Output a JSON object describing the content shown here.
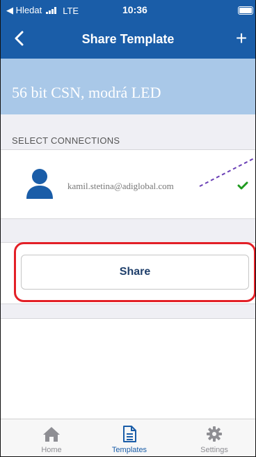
{
  "status_bar": {
    "carrier": "◀ Hledat",
    "network": "LTE",
    "time": "10:36"
  },
  "nav": {
    "title": "Share Template",
    "back_icon": "chevron-left-icon",
    "add_icon": "plus-icon",
    "add_label": "+"
  },
  "template": {
    "name": "56 bit CSN, modrá LED"
  },
  "connections": {
    "section_label": "SELECT CONNECTIONS",
    "items": [
      {
        "email": "kamil.stetina@adiglobal.com",
        "selected": true
      }
    ]
  },
  "share": {
    "label": "Share"
  },
  "tabs": [
    {
      "label": "Home",
      "icon": "home-icon",
      "active": false
    },
    {
      "label": "Templates",
      "icon": "document-icon",
      "active": true
    },
    {
      "label": "Settings",
      "icon": "gear-icon",
      "active": false
    }
  ],
  "colors": {
    "primary": "#1a5da8",
    "header_band": "#a9c8e8",
    "highlight": "#e32027",
    "check": "#1f9a1f",
    "annotation_line": "#6a3fb5"
  }
}
